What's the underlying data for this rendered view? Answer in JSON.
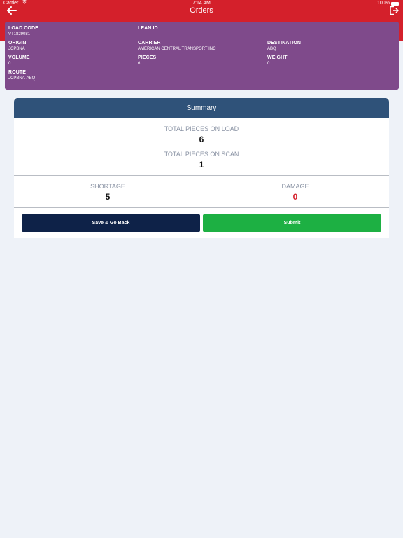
{
  "status_bar": {
    "carrier": "Carrier",
    "time": "7:14 AM",
    "battery": "100%"
  },
  "header": {
    "title": "Orders"
  },
  "load": {
    "load_code_label": "LOAD CODE",
    "load_code": "VT1829081",
    "lean_id_label": "LEAN ID",
    "lean_id": "-",
    "origin_label": "ORIGIN",
    "origin": "JCPBNA",
    "carrier_label": "CARRIER",
    "carrier": "AMERICAN CENTRAL TRANSPORT INC",
    "destination_label": "DESTINATION",
    "destination": "ABQ",
    "volume_label": "VOLUME",
    "volume": "0",
    "pieces_label": "PIECES",
    "pieces": "6",
    "weight_label": "WEIGHT",
    "weight": "0",
    "route_label": "ROUTE",
    "route": "JCPBNA-ABQ"
  },
  "summary": {
    "title": "Summary",
    "total_on_load_label": "TOTAL PIECES ON LOAD",
    "total_on_load": "6",
    "total_on_scan_label": "TOTAL PIECES ON SCAN",
    "total_on_scan": "1",
    "shortage_label": "SHORTAGE",
    "shortage": "5",
    "damage_label": "DAMAGE",
    "damage": "0"
  },
  "actions": {
    "save_back": "Save & Go Back",
    "submit": "Submit"
  },
  "colors": {
    "header": "#d4202b",
    "card": "#7f4a8b",
    "summary_header": "#2f5279",
    "save_button": "#0e2248",
    "submit_button": "#1db043",
    "damage_value": "#d4202b"
  },
  "icons": {
    "back": "arrow-left-icon",
    "logout": "logout-icon",
    "wifi": "wifi-icon",
    "battery": "battery-icon"
  }
}
